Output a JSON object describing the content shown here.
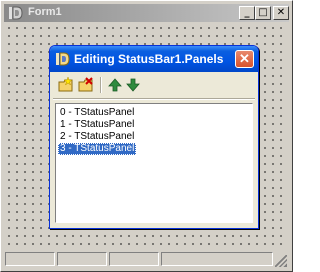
{
  "form": {
    "title": "Form1",
    "caption_buttons": {
      "minimize": "_",
      "maximize": "□",
      "close": "✕"
    },
    "statusbar_panel_count": 4
  },
  "dialog": {
    "title": "Editing StatusBar1.Panels",
    "close_glyph": "✕",
    "toolbar": {
      "add_icon": "add-new-icon",
      "delete_icon": "delete-icon",
      "move_up_icon": "move-up-arrow-icon",
      "move_down_icon": "move-down-arrow-icon"
    },
    "items": [
      "0 - TStatusPanel",
      "1 - TStatusPanel",
      "2 - TStatusPanel",
      "3 - TStatusPanel"
    ],
    "selected_index": 3
  },
  "colors": {
    "xp_title_blue": "#0054e3",
    "selection_blue": "#316ac5",
    "close_red": "#d9522b",
    "face": "#d4d0c8"
  }
}
